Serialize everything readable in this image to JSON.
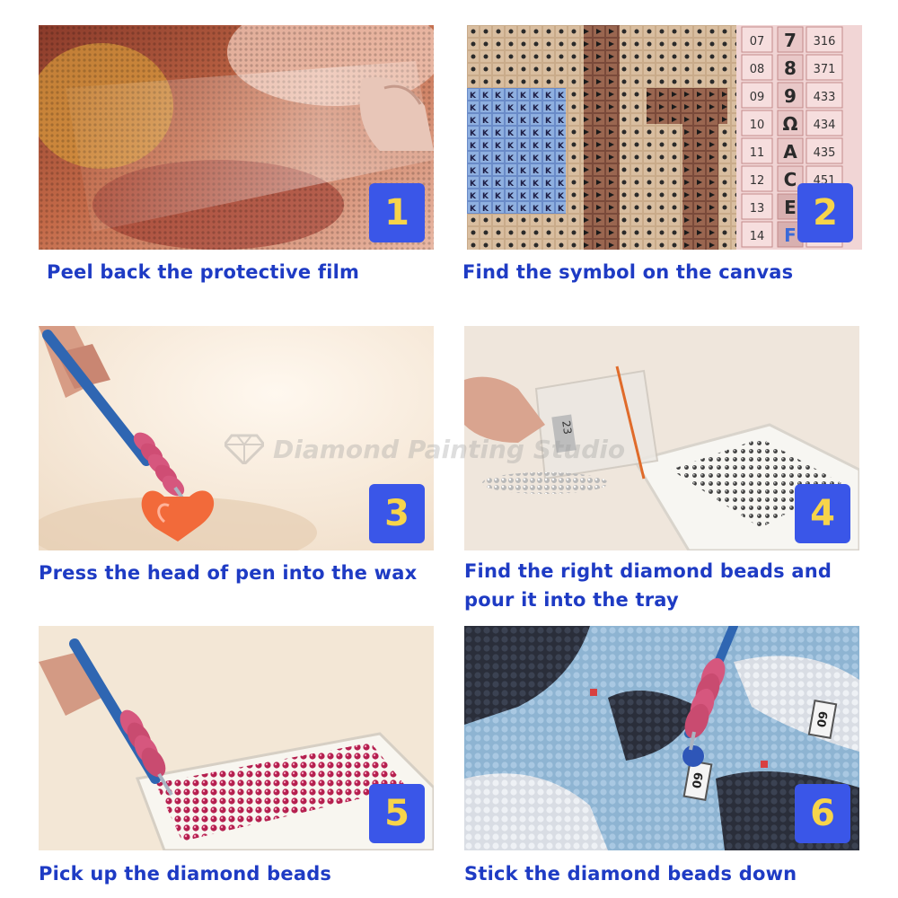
{
  "steps": [
    {
      "number": "1",
      "caption": "Peel back the protective film"
    },
    {
      "number": "2",
      "caption": "Find the symbol on the canvas"
    },
    {
      "number": "3",
      "caption": "Press the head of pen into the wax"
    },
    {
      "number": "4",
      "caption": "Find the right diamond beads and pour it into the tray"
    },
    {
      "number": "5",
      "caption": "Pick up the diamond beads"
    },
    {
      "number": "6",
      "caption": "Stick the diamond beads down"
    }
  ],
  "legend_rows": [
    {
      "index": "07",
      "symbol": "7",
      "code": "316"
    },
    {
      "index": "08",
      "symbol": "8",
      "code": "371"
    },
    {
      "index": "09",
      "symbol": "9",
      "code": "433"
    },
    {
      "index": "10",
      "symbol": "Ω",
      "code": "434"
    },
    {
      "index": "11",
      "symbol": "A",
      "code": "435"
    },
    {
      "index": "12",
      "symbol": "C",
      "code": "451"
    },
    {
      "index": "13",
      "symbol": "E",
      "code": ""
    },
    {
      "index": "14",
      "symbol": "F",
      "code": ""
    }
  ],
  "bag_label": "23",
  "canvas_labels": [
    "60",
    "60"
  ],
  "watermark": "Diamond Painting Studio",
  "colors": {
    "badge_bg": "#3a56e8",
    "badge_text": "#f7d44a",
    "caption_text": "#1e3bc4"
  },
  "icons": [
    "diamond-logo-icon"
  ]
}
